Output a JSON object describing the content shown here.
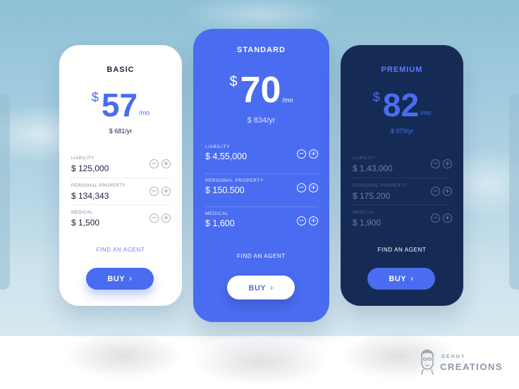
{
  "plans": {
    "basic": {
      "name": "BASIC",
      "currency": "$",
      "amount": "57",
      "period": "/mo",
      "yearly": "$ 681/yr",
      "rows": [
        {
          "label": "LIABILITY",
          "value": "$ 125,000"
        },
        {
          "label": "PERSONAL PROPERTY",
          "value": "$ 134,343"
        },
        {
          "label": "MEDICAL",
          "value": "$ 1,500"
        }
      ],
      "agent_link": "FIND AN AGENT",
      "buy_label": "BUY",
      "chevron": "›"
    },
    "standard": {
      "name": "STANDARD",
      "currency": "$",
      "amount": "70",
      "period": "/mo",
      "yearly": "$ 834/yr",
      "rows": [
        {
          "label": "LIABILITY",
          "value": "$ 4,55,000"
        },
        {
          "label": "PERSONAL PROPERTY",
          "value": "$ 150.500"
        },
        {
          "label": "MEDICAL",
          "value": "$ 1,600"
        }
      ],
      "agent_link": "FIND AN AGENT",
      "buy_label": "BUY",
      "chevron": "›"
    },
    "premium": {
      "name": "PREMIUM",
      "currency": "$",
      "amount": "82",
      "period": "/mo",
      "yearly": "$ 979/yr",
      "rows": [
        {
          "label": "LIABILITY",
          "value": "$ 1,43,000"
        },
        {
          "label": "PERSONAL PROPERTY",
          "value": "$ 175.200"
        },
        {
          "label": "MEDICAL",
          "value": "$ 1,900"
        }
      ],
      "agent_link": "FIND AN AGENT",
      "buy_label": "BUY",
      "chevron": "›"
    }
  },
  "controls": {
    "minus": "−",
    "plus": "+"
  },
  "logo": {
    "top": "DENNY",
    "bottom": "CREATIONS"
  },
  "colors": {
    "accent": "#4a6cf0",
    "premium_bg": "#152b55",
    "ink": "#1a2340"
  }
}
